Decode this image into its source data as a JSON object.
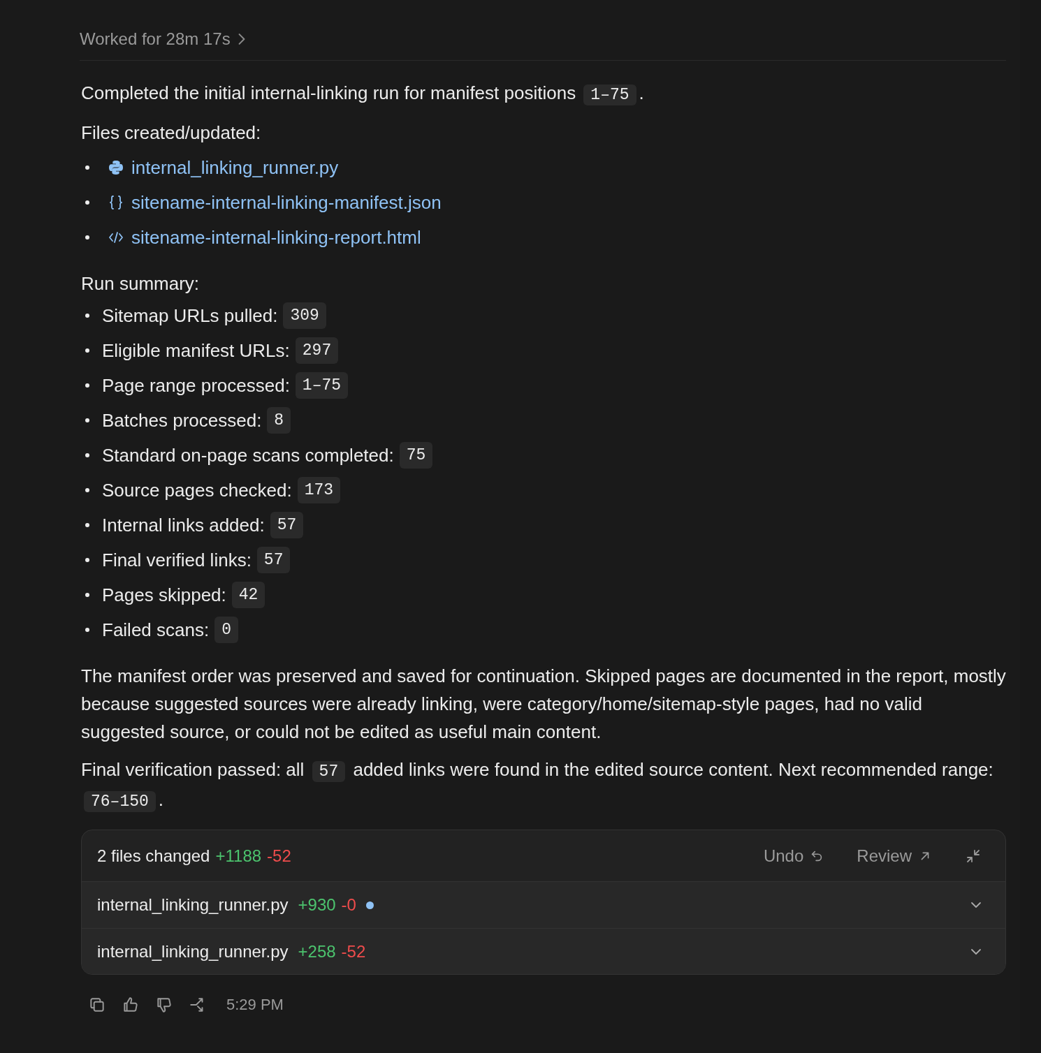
{
  "worked_for": "Worked for 28m 17s",
  "intro": [
    {
      "kind": "text",
      "text": "Completed the initial internal-linking run for manifest positions "
    },
    {
      "kind": "code",
      "text": "1–75"
    },
    {
      "kind": "text",
      "text": "."
    }
  ],
  "files_heading": "Files created/updated:",
  "files": [
    {
      "kind": "python",
      "name": "internal_linking_runner.py"
    },
    {
      "kind": "json",
      "name": "sitename-internal-linking-manifest.json"
    },
    {
      "kind": "html",
      "name": "sitename-internal-linking-report.html"
    }
  ],
  "summary_heading": "Run summary:",
  "summary": [
    {
      "label": "Sitemap URLs pulled:",
      "value": "309"
    },
    {
      "label": "Eligible manifest URLs:",
      "value": "297"
    },
    {
      "label": "Page range processed:",
      "value": "1–75"
    },
    {
      "label": "Batches processed:",
      "value": "8"
    },
    {
      "label": "Standard on-page scans completed:",
      "value": "75"
    },
    {
      "label": "Source pages checked:",
      "value": "173"
    },
    {
      "label": "Internal links added:",
      "value": "57"
    },
    {
      "label": "Final verified links:",
      "value": "57"
    },
    {
      "label": "Pages skipped:",
      "value": "42"
    },
    {
      "label": "Failed scans:",
      "value": "0"
    }
  ],
  "note": "The manifest order was preserved and saved for continuation. Skipped pages are documented in the report, mostly because suggested sources were already linking, were category/home/sitemap-style pages, had no valid suggested source, or could not be edited as useful main content.",
  "verification": [
    {
      "kind": "text",
      "text": "Final verification passed: all "
    },
    {
      "kind": "code",
      "text": "57"
    },
    {
      "kind": "text",
      "text": " added links were found in the edited source content. Next recommended range: "
    },
    {
      "kind": "code",
      "text": "76–150"
    },
    {
      "kind": "text",
      "text": "."
    }
  ],
  "changes": {
    "title": "2 files changed",
    "added": "+1188",
    "removed": "-52",
    "undo": "Undo",
    "review": "Review",
    "files": [
      {
        "name": "internal_linking_runner.py",
        "added": "+930",
        "removed": "-0",
        "marked": true
      },
      {
        "name": "internal_linking_runner.py",
        "added": "+258",
        "removed": "-52",
        "marked": false
      }
    ]
  },
  "time": "5:29 PM"
}
